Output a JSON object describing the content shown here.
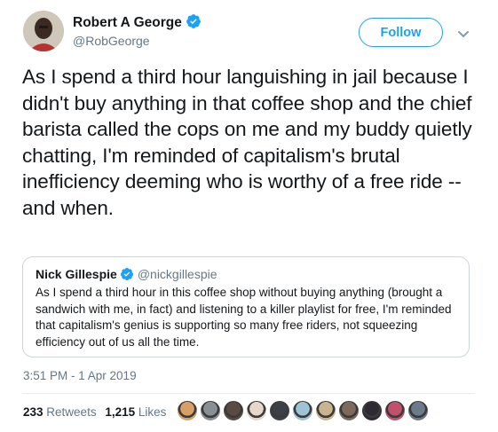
{
  "author": {
    "name": "Robert A George",
    "handle": "@RobGeorge",
    "verified": true
  },
  "follow_button": {
    "label": "Follow"
  },
  "menu": {
    "icon": "chevron-down-icon"
  },
  "tweet": {
    "text": "As I spend a third hour languishing in jail because I didn't buy anything in that coffee shop and the chief barista called the cops on me and my buddy quietly chatting, I'm reminded of capitalism's brutal inefficiency deeming who is worthy of a free ride -- and when."
  },
  "quoted_tweet": {
    "name": "Nick Gillespie",
    "handle": "@nickgillespie",
    "verified": true,
    "text": "As I spend a third hour in this coffee shop without buying anything (brought a sandwich with me, in fact) and listening to a killer playlist for free, I'm reminded that capitalism's genius is supporting so many free riders, not squeezing efficiency out of us all the time."
  },
  "timestamp": "3:51 PM - 1 Apr 2019",
  "stats": {
    "retweets_count": "233",
    "retweets_label": "Retweets",
    "likes_count": "1,215",
    "likes_label": "Likes"
  },
  "likers": [
    "#d9a066",
    "#8a8f96",
    "#5b4a44",
    "#e7d7c9",
    "#3c3f45",
    "#9fc3d6",
    "#c9b48f",
    "#7e6a5d",
    "#2d2a33",
    "#c0506b",
    "#6c7b8b"
  ],
  "colors": {
    "accent": "#1da1f2",
    "secondary_text": "#657786",
    "primary_text": "#14171a",
    "border": "#ccd6dd"
  }
}
